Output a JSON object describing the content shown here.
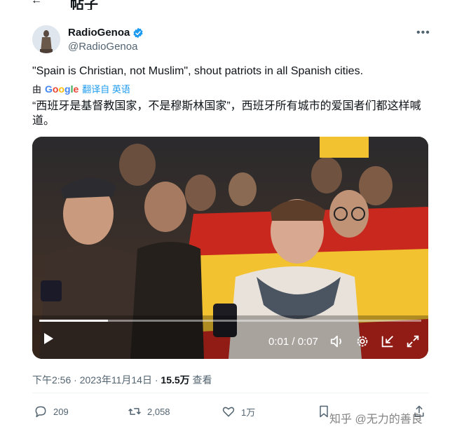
{
  "header": {
    "back_icon": "arrow-left-icon",
    "title": "帖子"
  },
  "author": {
    "display_name": "RadioGenoa",
    "handle": "@RadioGenoa",
    "verified_icon": "verified-badge-icon",
    "more_icon": "more-horizontal-icon"
  },
  "tweet": {
    "text": "\"Spain is Christian, not Muslim\", shout patriots in all Spanish cities.",
    "translate_by": "由",
    "translate_provider": "Google",
    "translate_link": "翻译自 英语",
    "translated_text": "“西班牙是基督教国家，不是穆斯林国家”，西班牙所有城市的爱国者们都这样喊道。"
  },
  "video": {
    "time": "0:01 / 0:07",
    "progress": 0.18,
    "controls": [
      "play-icon",
      "volume-icon",
      "settings-icon",
      "dock-icon",
      "fullscreen-icon"
    ]
  },
  "meta": {
    "time": "下午2:56",
    "separator": "·",
    "date": "2023年11月14日",
    "views": "15.5万",
    "views_label": "查看"
  },
  "actions": {
    "replies": "209",
    "retweets": "2,058",
    "likes": "1万"
  },
  "watermark": "知乎 @无力的善良",
  "colors": {
    "accent": "#1d9bf0",
    "secondary_text": "#536471",
    "flag_red": "#c8281e",
    "flag_yellow": "#f2c230"
  }
}
